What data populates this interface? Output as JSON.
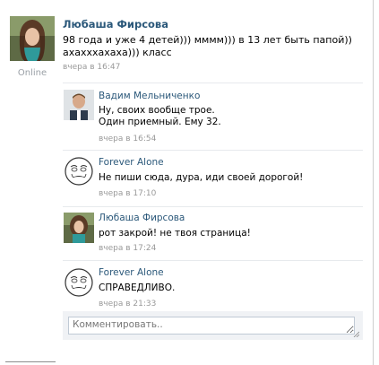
{
  "post": {
    "author": "Любаша Фирсова",
    "status": "Online",
    "text_line1": "98 года и уже 4 детей))) мммм))) в 13 лет быть папой))",
    "text_line2": "ахахххахаха))) класс",
    "date": "вчера в 16:47"
  },
  "comments": [
    {
      "author": "Вадим Мельниченко",
      "line1": "Ну, своих вообще трое.",
      "line2": "Один приемный. Ему 32.",
      "date": "вчера в 16:54"
    },
    {
      "author": "Forever Alone",
      "line1": "Не пиши сюда, дура, иди своей дорогой!",
      "line2": "",
      "date": "вчера в 17:10"
    },
    {
      "author": "Любаша Фирсова",
      "line1": "рот закрой! не твоя страница!",
      "line2": "",
      "date": "вчера в 17:24"
    },
    {
      "author": "Forever Alone",
      "line1": "СПРАВЕДЛИВО.",
      "line2": "",
      "date": "вчера в 21:33"
    }
  ],
  "reply": {
    "placeholder": "Комментировать.."
  },
  "colors": {
    "link": "#2b587a",
    "muted": "#999999",
    "separator": "#e7eaed",
    "reply_bg": "#f0f2f5"
  },
  "icons": {
    "forever_alone": "forever-alone-meme-face-icon"
  }
}
